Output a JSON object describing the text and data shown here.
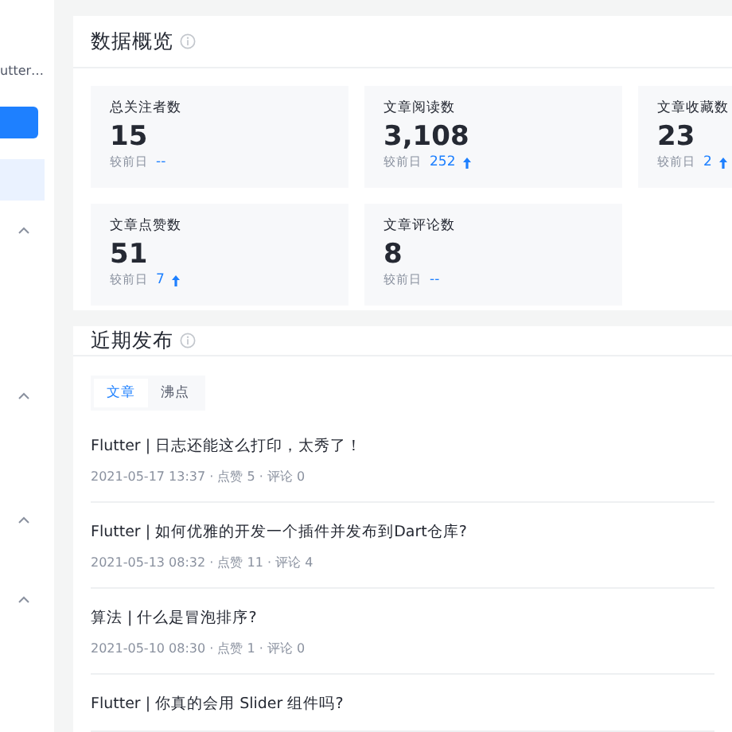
{
  "sidebar": {
    "item_text": "utter…",
    "items": [
      {
        "kind": "button"
      },
      {
        "kind": "selected"
      },
      {
        "kind": "chevron"
      },
      {
        "kind": "chevron"
      },
      {
        "kind": "chevron"
      },
      {
        "kind": "chevron"
      }
    ]
  },
  "overview": {
    "title": "数据概览",
    "stats": [
      {
        "label": "总关注者数",
        "value": "15",
        "compare_label": "较前日",
        "change": "--",
        "kind": "flat"
      },
      {
        "label": "文章阅读数",
        "value": "3,108",
        "compare_label": "较前日",
        "change": "252",
        "kind": "up"
      },
      {
        "label": "文章收藏数",
        "value": "23",
        "compare_label": "较前日",
        "change": "2",
        "kind": "up"
      },
      {
        "label": "文章点赞数",
        "value": "51",
        "compare_label": "较前日",
        "change": "7",
        "kind": "up"
      },
      {
        "label": "文章评论数",
        "value": "8",
        "compare_label": "较前日",
        "change": "--",
        "kind": "flat"
      }
    ]
  },
  "recent": {
    "title": "近期发布",
    "tabs": [
      {
        "label": "文章",
        "selected": true
      },
      {
        "label": "沸点",
        "selected": false
      }
    ],
    "articles": [
      {
        "title": "Flutter | 日志还能这么打印，太秀了！",
        "meta": "2021-05-17 13:37 · 点赞 5 · 评论 0"
      },
      {
        "title": "Flutter | 如何优雅的开发一个插件并发布到Dart仓库?",
        "meta": "2021-05-13 08:32 · 点赞 11 · 评论 4"
      },
      {
        "title": "算法 | 什么是冒泡排序?",
        "meta": "2021-05-10 08:30 · 点赞 1 · 评论 0"
      },
      {
        "title": "Flutter | 你真的会用 Slider 组件吗?"
      }
    ]
  }
}
